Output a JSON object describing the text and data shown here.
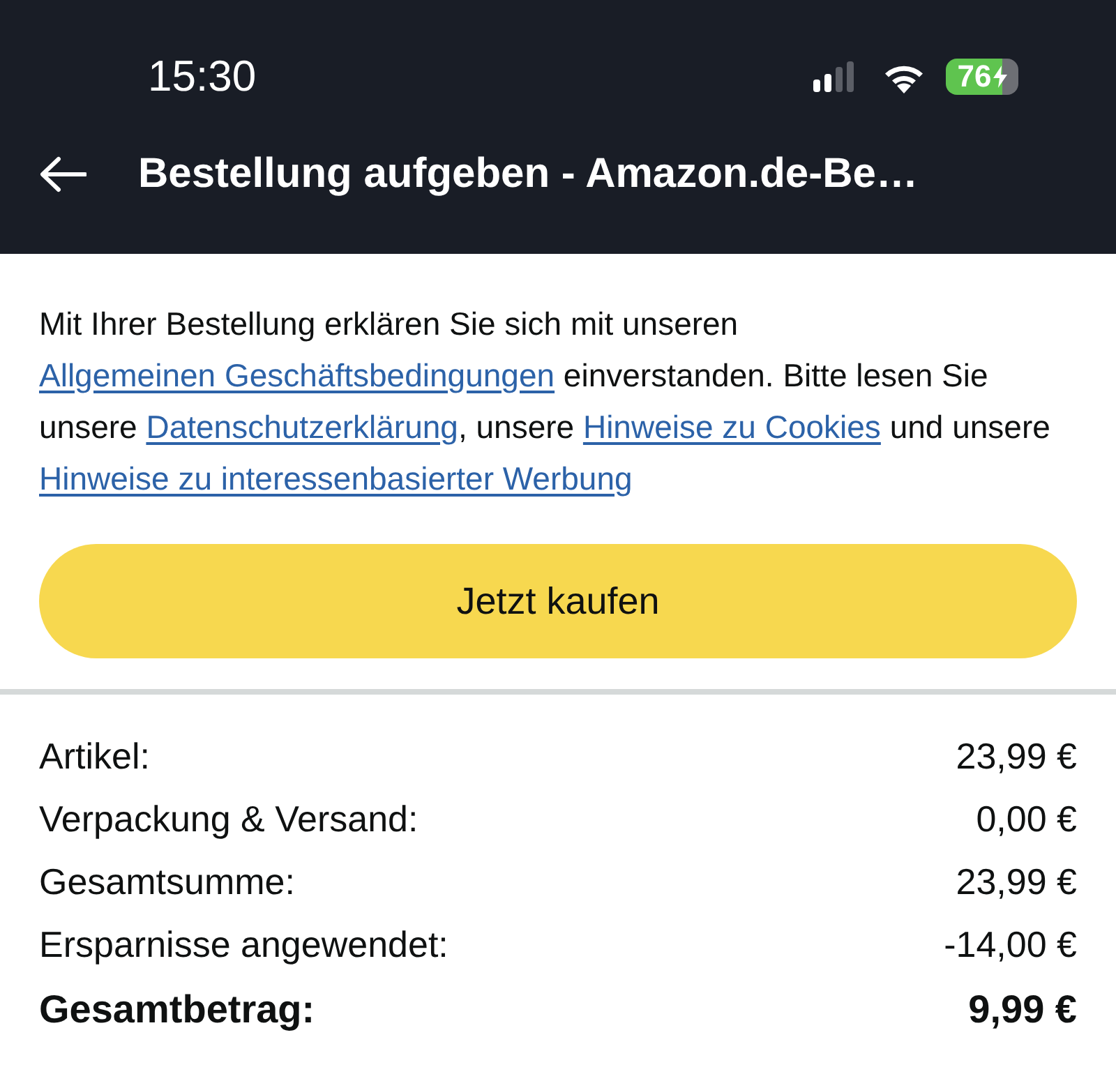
{
  "status_bar": {
    "time": "15:30",
    "battery": "76"
  },
  "header": {
    "title": "Bestellung aufgeben - Amazon.de-Be…"
  },
  "legal_notice": {
    "parts": [
      {
        "kind": "text",
        "text": "Mit Ihrer Bestellung erklären Sie sich mit unseren "
      },
      {
        "kind": "link",
        "text": "Allgemeinen Geschäftsbedingungen"
      },
      {
        "kind": "text",
        "text": " einverstanden. Bitte lesen Sie unsere "
      },
      {
        "kind": "link",
        "text": "Datenschutzerklärung"
      },
      {
        "kind": "text",
        "text": ", unsere "
      },
      {
        "kind": "link",
        "text": "Hinweise zu Cookies"
      },
      {
        "kind": "text",
        "text": " und unsere "
      },
      {
        "kind": "link",
        "text": "Hinweise zu interessenbasierter Werbung"
      }
    ]
  },
  "buy_button": {
    "label": "Jetzt kaufen"
  },
  "summary": {
    "rows": [
      {
        "kind": "line",
        "label": "Artikel:",
        "amount": "23,99 €"
      },
      {
        "kind": "line",
        "label": "Verpackung & Versand:",
        "amount": "0,00 €"
      },
      {
        "kind": "line",
        "label": "Gesamtsumme:",
        "amount": "23,99 €"
      },
      {
        "kind": "line",
        "label": "Ersparnisse angewendet:",
        "amount": "-14,00 €"
      },
      {
        "kind": "total",
        "label": "Gesamtbetrag:",
        "amount": "9,99 €"
      }
    ]
  }
}
